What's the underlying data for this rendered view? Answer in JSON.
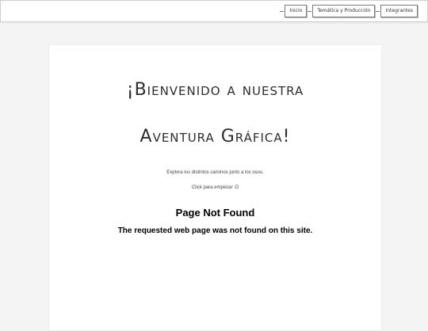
{
  "nav": {
    "items": [
      {
        "label": "Inicio"
      },
      {
        "label": "Temática y Producción"
      },
      {
        "label": "Integrantes"
      }
    ]
  },
  "hero": {
    "title_line1": "¡Bienvenido a nuestra",
    "title_line2": "Aventura Gráfica!",
    "subtitle": "Explora los distintos caminos junto a los osos.",
    "cta": "Click para empezar :D"
  },
  "error": {
    "title": "Page Not Found",
    "message": "The requested web page was not found on this site."
  }
}
